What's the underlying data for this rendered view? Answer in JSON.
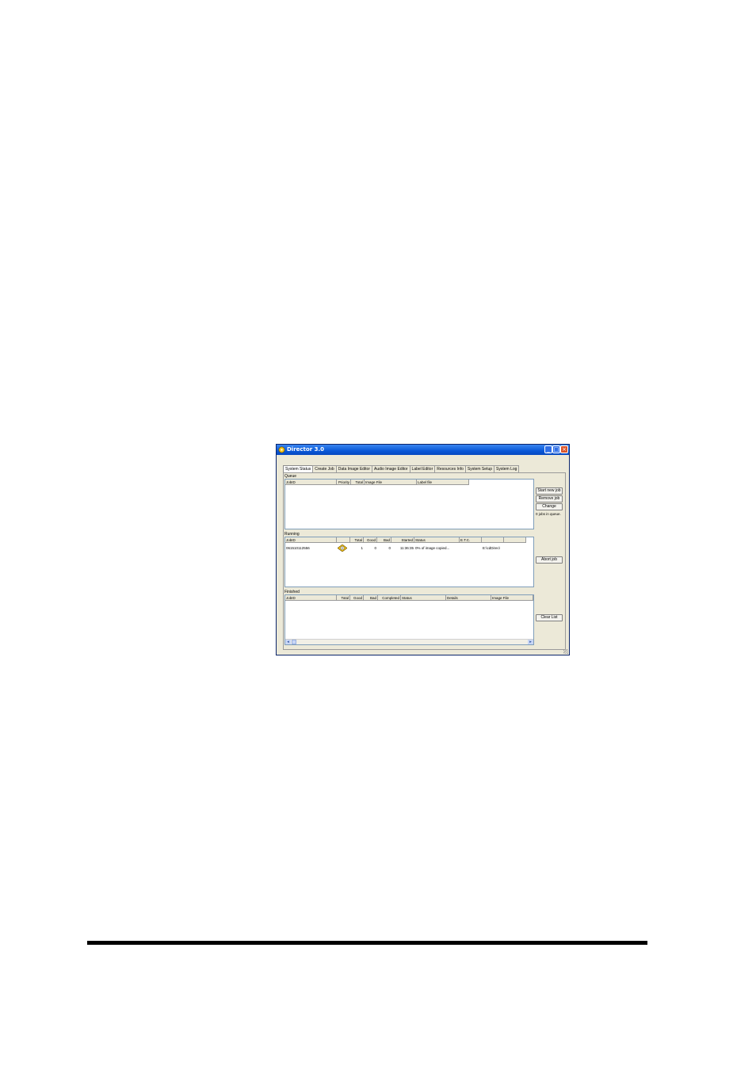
{
  "window": {
    "title": "Director 3.0",
    "controls": {
      "minimize": "_",
      "maximize": "□",
      "close": "×"
    }
  },
  "tabs": [
    {
      "label": "System Status",
      "active": true
    },
    {
      "label": "Create Job",
      "active": false
    },
    {
      "label": "Data Image Editor",
      "active": false
    },
    {
      "label": "Audio Image Editor",
      "active": false
    },
    {
      "label": "Label Editor",
      "active": false
    },
    {
      "label": "Resources Info",
      "active": false
    },
    {
      "label": "System Setup",
      "active": false
    },
    {
      "label": "System Log",
      "active": false
    }
  ],
  "queue": {
    "label": "Queue",
    "columns": [
      "JobID",
      "Priority",
      "Total",
      "Image File",
      "Label file"
    ],
    "rows": [],
    "buttons": {
      "start": "Start new job",
      "remove": "Remove job",
      "change": "Change"
    },
    "count_text": "0 jobs in queue."
  },
  "running": {
    "label": "Running",
    "columns": [
      "JobID",
      "",
      "Total",
      "Good",
      "Bad",
      "Started",
      "Status",
      "E.T.C.",
      "",
      ""
    ],
    "rows": [
      {
        "jobid": "061510112556",
        "icon": "burning-disc-icon",
        "total": "1",
        "good": "0",
        "bad": "0",
        "started": "11:36:35",
        "status": "0% of image copied...",
        "etc": "",
        "path": "E:\\cdDirec\\"
      }
    ],
    "buttons": {
      "abort": "Abort job"
    }
  },
  "finished": {
    "label": "Finished",
    "columns": [
      "JobID",
      "Total",
      "Good",
      "Bad",
      "Completed",
      "Status",
      "Details",
      "Image File"
    ],
    "rows": [],
    "buttons": {
      "clear": "Clear List"
    }
  },
  "colors": {
    "titlebar": "#0a58d8",
    "window_bg": "#ece9d8",
    "close_button": "#d9542a"
  }
}
